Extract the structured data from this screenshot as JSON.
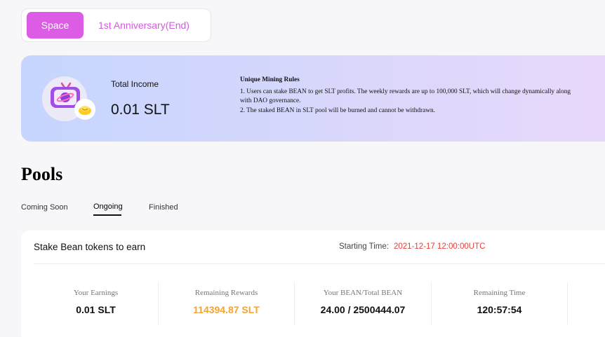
{
  "top_tabs": {
    "space": "Space",
    "anniversary": "1st Anniversary(End)"
  },
  "banner": {
    "income_label": "Total Income",
    "income_value": "0.01 SLT",
    "rules_title": "Unique Mining Rules",
    "rule_1": "1. Users can stake BEAN to get SLT profits. The weekly rewards are up to 100,000 SLT, which will change dynamically along with DAO governance.",
    "rule_2": "2. The staked BEAN in SLT pool will be burned and cannot be withdrawn."
  },
  "pools": {
    "title": "Pools",
    "tabs": [
      "Coming Soon",
      "Ongoing",
      "Finished"
    ],
    "active_tab": "Ongoing"
  },
  "card": {
    "title": "Stake Bean tokens to earn",
    "start_label": "Starting Time:",
    "start_value": "2021-12-17 12:00:00UTC",
    "stats": [
      {
        "label": "Your Earnings",
        "value": "0.01 SLT"
      },
      {
        "label": "Remaining Rewards",
        "value": "114394.87 SLT"
      },
      {
        "label": "Your BEAN/Total BEAN",
        "value": "24.00 / 2500444.07"
      },
      {
        "label": "Remaining Time",
        "value": "120:57:54"
      }
    ]
  },
  "colors": {
    "accent": "#dc5ce6",
    "orange": "#f4a336",
    "red": "#e2403d"
  }
}
